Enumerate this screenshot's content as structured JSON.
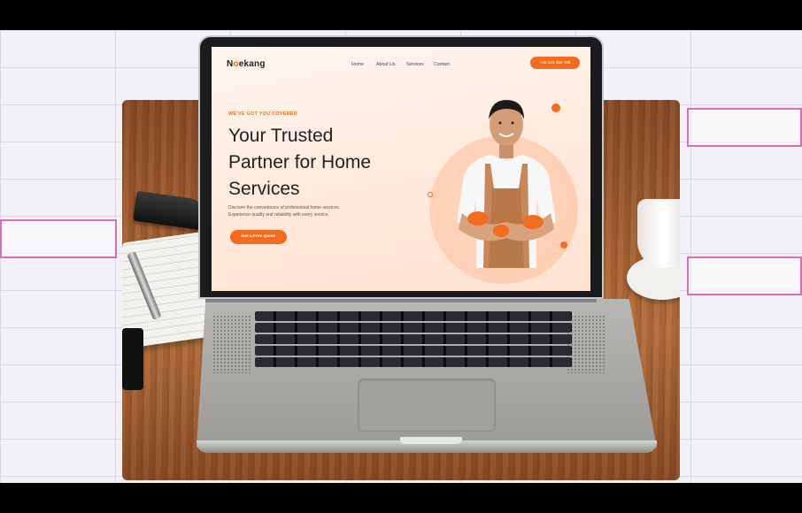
{
  "site": {
    "logo": {
      "prefix": "N",
      "o": "o",
      "rest": "ekang"
    },
    "nav": [
      "Home",
      "About Us",
      "Services",
      "Contact"
    ],
    "phone_cta": "+40 123 456 789",
    "eyebrow": "WE'VE GOT YOU COVERED",
    "headline": [
      "Your Trusted",
      "Partner for Home",
      "Services"
    ],
    "description": [
      "Discover the convenience of professional home services.",
      "Experience quality and reliability with every service."
    ],
    "hero_cta": "Get a Free Quote"
  },
  "colors": {
    "accent": "#f36b21",
    "text": "#222222",
    "hero_bg": "#ffe9dc"
  }
}
